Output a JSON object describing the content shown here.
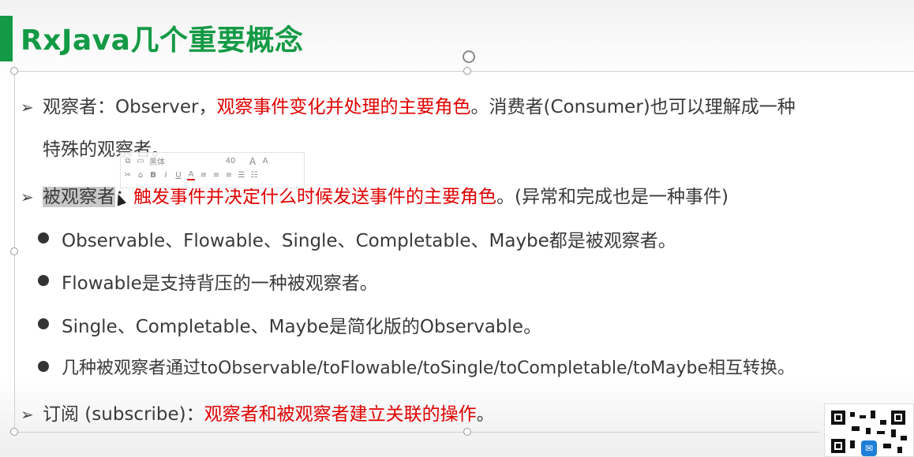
{
  "slide": {
    "title": "RxJava几个重要概念",
    "accent_color": "#149a45",
    "highlight_color": "#e00000"
  },
  "items": [
    {
      "marker": "➢",
      "label": "观察者：Observer，",
      "highlight": "观察事件变化并处理的主要角色",
      "rest": "。消费者(Consumer)也可以理解成一种",
      "continuation": "特殊的观察者。"
    },
    {
      "marker": "➢",
      "label_selected": "被观察者",
      "label_colon": "：",
      "highlight": "触发事件并决定什么时候发送事件的主要角色",
      "rest": "。(异常和完成也是一种事件)"
    },
    {
      "marker": "➢",
      "label": "订阅 (subscribe)：",
      "highlight": "观察者和被观察者建立关联的操作",
      "rest": "。"
    }
  ],
  "bullets": [
    "Observable、Flowable、Single、Completable、Maybe都是被观察者。",
    "Flowable是支持背压的一种被观察者。",
    "Single、Completable、Maybe是简化版的Observable。",
    "几种被观察者通过toObservable/toFlowable/toSingle/toCompletable/toMaybe相互转换。"
  ],
  "mini_toolbar": {
    "font_name": "黑体",
    "font_size": "40",
    "grow_font": "A",
    "shrink_font": "A",
    "bold": "B",
    "italic": "I",
    "underline": "U",
    "font_color": "A"
  },
  "icons": {
    "cut": "cut-icon",
    "copy": "copy-icon",
    "paste": "paste-icon",
    "format_painter": "format-painter-icon",
    "qr": "qr-code-icon",
    "message": "message-icon"
  }
}
